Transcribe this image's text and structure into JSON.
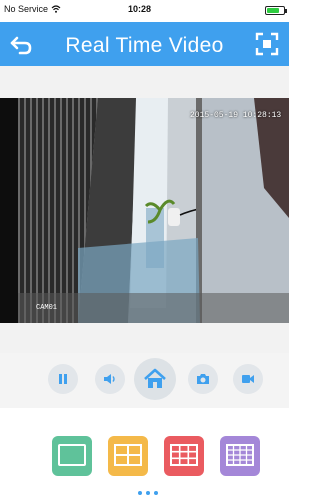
{
  "status_bar": {
    "carrier": "No Service",
    "time": "10:28"
  },
  "nav": {
    "title": "Real Time Video",
    "back_icon": "back-arrow-icon",
    "fullscreen_icon": "fullscreen-icon",
    "background": "#3fa0ee"
  },
  "video": {
    "timestamp": "2015-05-19 10:28:13",
    "camera_label": "CAM01"
  },
  "controls": {
    "icons": [
      "pause-icon",
      "volume-icon",
      "home-icon",
      "snapshot-camera-icon",
      "record-video-icon"
    ]
  },
  "layouts": {
    "buttons": [
      {
        "name": "single-view",
        "color": "#5fc29a"
      },
      {
        "name": "four-view",
        "color": "#f4b949"
      },
      {
        "name": "nine-view",
        "color": "#ea5b60"
      },
      {
        "name": "sixteen-view",
        "color": "#a487d8"
      }
    ],
    "page_dots": 3
  }
}
